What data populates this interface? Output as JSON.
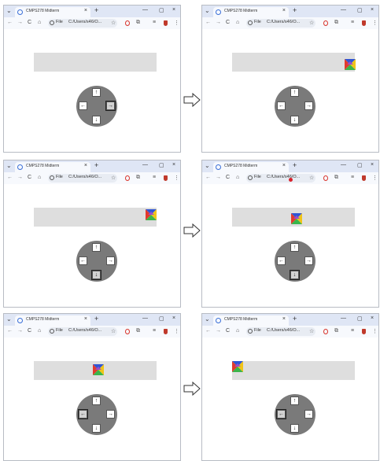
{
  "tab": {
    "menu_glyph": "⌄",
    "title": "CMPS278 Midterm",
    "close_glyph": "×",
    "new_tab_glyph": "+"
  },
  "window": {
    "minimize_glyph": "—",
    "maximize_glyph": "▢",
    "close_glyph": "×"
  },
  "toolbar": {
    "back_glyph": "←",
    "forward_glyph": "→",
    "reload_glyph": "C",
    "home_glyph": "⌂",
    "file_label": "File",
    "url": "C:/Users/s46/O...",
    "star_glyph": "☆",
    "extensions_glyph": "⧉",
    "profile_glyph": "≡",
    "menu_glyph": "⋮"
  },
  "dpad": {
    "up_glyph": "↑",
    "down_glyph": "↓",
    "left_glyph": "←",
    "right_glyph": "→"
  },
  "icons": {
    "opera": "opera-icon",
    "shield": "shield-icon",
    "sprite": "color-triangles-sprite",
    "flow": "hollow-right-arrow"
  },
  "colors": {
    "track": "#dedede",
    "dpad": "#7a7a7a",
    "tab_bar": "#dfe6f5",
    "sprite_blue": "#2f55d4",
    "sprite_red": "#e23a2c",
    "sprite_yellow": "#f0c419",
    "sprite_green": "#3ab54a",
    "sprite_purple": "#9b4dca"
  },
  "panels": [
    {
      "sprite_visible": false,
      "pressed": "right"
    },
    {
      "sprite_visible": true,
      "pressed": "none"
    },
    {
      "sprite_visible": true,
      "pressed": "down"
    },
    {
      "sprite_visible": true,
      "pressed": "down"
    },
    {
      "sprite_visible": true,
      "pressed": "left"
    },
    {
      "sprite_visible": true,
      "pressed": "left"
    }
  ]
}
